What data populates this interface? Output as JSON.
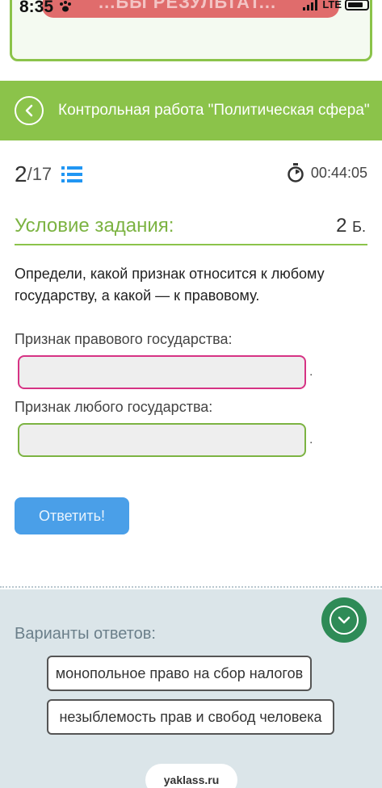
{
  "status_bar": {
    "time": "8:35",
    "network": "LTE",
    "notification_text": "...ЬЫ РЕЗУЛЬТАТ..."
  },
  "header": {
    "title": "Контрольная работа \"Политическая сфера\""
  },
  "progress": {
    "current": "2",
    "total": "/17",
    "timer": "00:44:05"
  },
  "condition": {
    "title": "Условие задания:",
    "points": "2",
    "points_unit": "Б."
  },
  "question": {
    "text": "Определи, какой признак относится к любому государству, а какой — к правовому.",
    "label_rule_of_law": "Признак правового государства:",
    "label_any_state": "Признак любого государства:",
    "slot_suffix": "."
  },
  "submit": {
    "label": "Ответить!"
  },
  "answers": {
    "title": "Варианты ответов:",
    "options": [
      "монопольное право на сбор налогов",
      "незыблемость прав и свобод человека"
    ]
  },
  "browser": {
    "url": "yaklass.ru"
  },
  "colors": {
    "accent_green": "#8bc34a",
    "submit_blue": "#4a9fe8",
    "slot1_border": "#d63384",
    "slot2_border": "#7cb342"
  }
}
